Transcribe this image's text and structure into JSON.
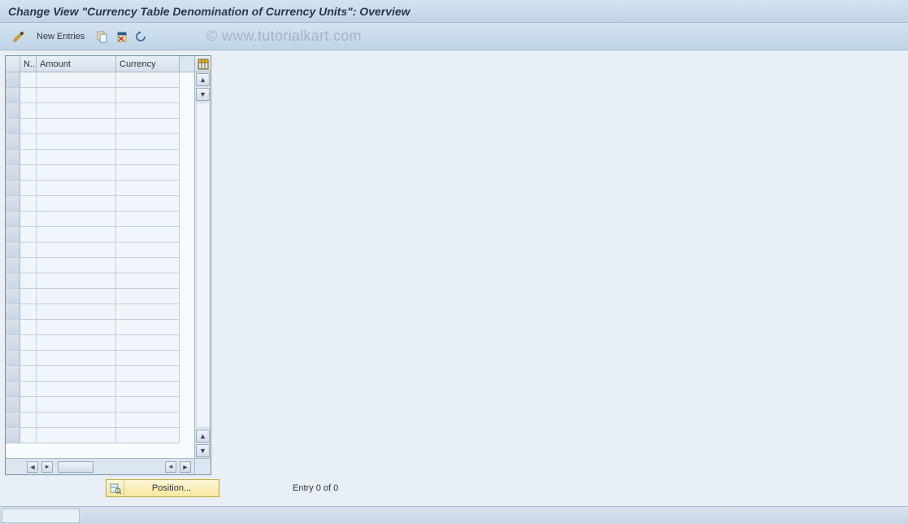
{
  "title": "Change View \"Currency Table Denomination of Currency Units\": Overview",
  "watermark": "© www.tutorialkart.com",
  "toolbar": {
    "new_entries_label": "New Entries"
  },
  "table": {
    "columns": {
      "n": "N..",
      "amount": "Amount",
      "currency": "Currency"
    },
    "row_count": 24
  },
  "footer": {
    "position_label": "Position...",
    "entry_status": "Entry 0 of 0"
  }
}
